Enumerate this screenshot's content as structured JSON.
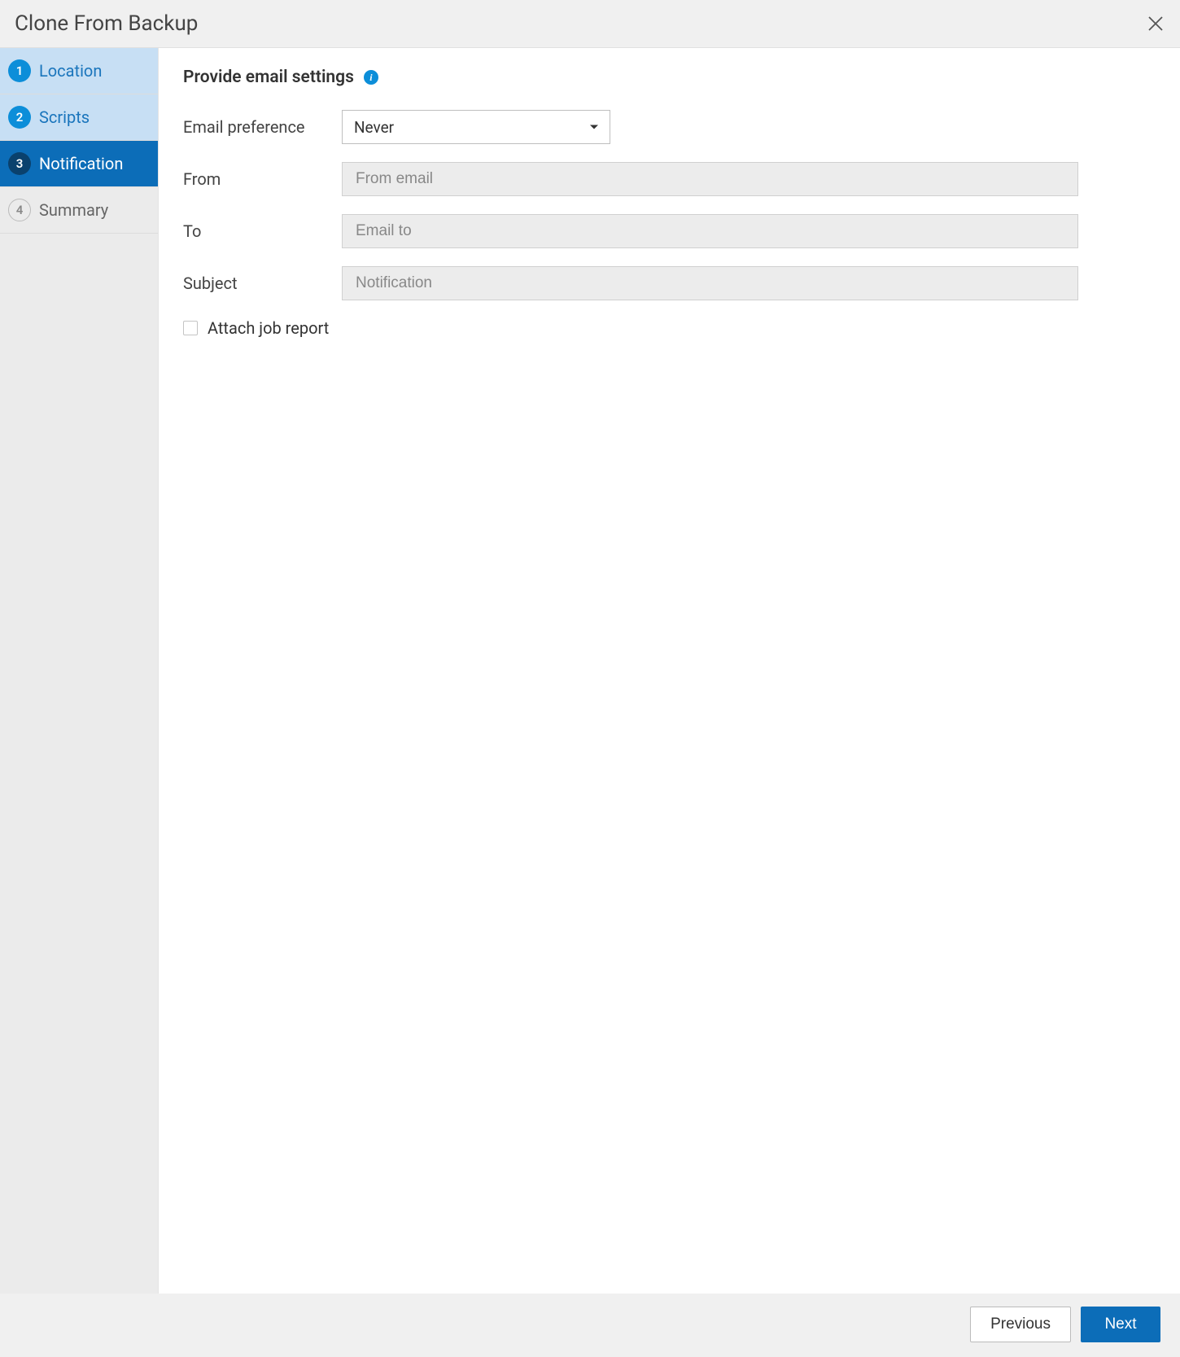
{
  "header": {
    "title": "Clone From Backup"
  },
  "sidebar": {
    "steps": [
      {
        "num": "1",
        "label": "Location",
        "state": "completed"
      },
      {
        "num": "2",
        "label": "Scripts",
        "state": "completed"
      },
      {
        "num": "3",
        "label": "Notification",
        "state": "active"
      },
      {
        "num": "4",
        "label": "Summary",
        "state": "upcoming"
      }
    ]
  },
  "main": {
    "title": "Provide email settings",
    "fields": {
      "email_preference": {
        "label": "Email preference",
        "value": "Never"
      },
      "from": {
        "label": "From",
        "placeholder": "From email",
        "value": ""
      },
      "to": {
        "label": "To",
        "placeholder": "Email to",
        "value": ""
      },
      "subject": {
        "label": "Subject",
        "placeholder": "Notification",
        "value": ""
      }
    },
    "attach_label": "Attach job report",
    "attach_checked": false
  },
  "footer": {
    "previous": "Previous",
    "next": "Next"
  }
}
